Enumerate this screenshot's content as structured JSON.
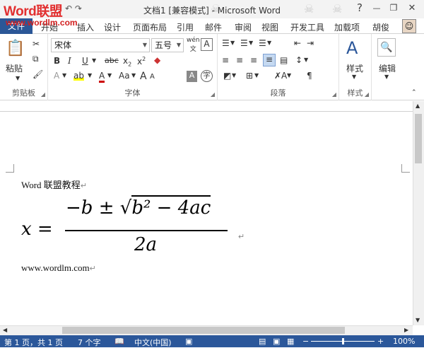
{
  "window": {
    "title": "文档1 [兼容模式] - Microsoft Word",
    "watermark": "Word联盟",
    "watermark_url": "www.wordlm.com",
    "help": "?",
    "minimize": "—",
    "restore": "❐",
    "close": "✕"
  },
  "tabs": {
    "file": "文件",
    "items": [
      "开始",
      "插入",
      "设计",
      "页面布局",
      "引用",
      "邮件",
      "审阅",
      "视图",
      "开发工具",
      "加载项"
    ],
    "user": "胡俊"
  },
  "ribbon": {
    "clipboard": {
      "label": "剪贴板",
      "paste": "粘贴"
    },
    "font": {
      "label": "字体",
      "font_name": "宋体",
      "font_size": "五号"
    },
    "paragraph": {
      "label": "段落"
    },
    "styles": {
      "label": "样式",
      "button": "样式"
    },
    "editing": {
      "button": "编辑"
    }
  },
  "document": {
    "line1": "Word 联盟教程",
    "line2": "www.wordlm.com",
    "equation": {
      "lhs": "x =",
      "numerator": "−b ± √",
      "radicand": "b² − 4ac",
      "denominator": "2a"
    },
    "para_mark": "↵"
  },
  "status": {
    "page": "第 1 页，共 1 页",
    "words": "7 个字",
    "language": "中文(中国)",
    "zoom": "100%"
  }
}
